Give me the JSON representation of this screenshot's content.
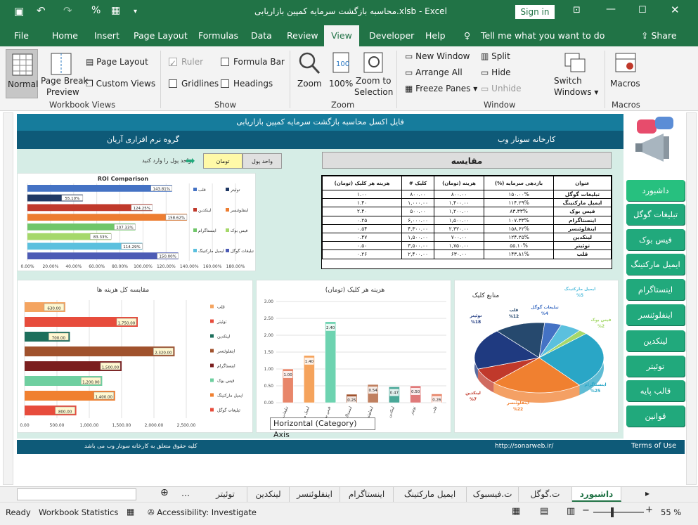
{
  "window": {
    "title": "محاسبه بازگشت سرمایه کمپین بازاریابی.xlsb",
    "app": "Excel",
    "sign_in": "Sign in"
  },
  "ribbon_tabs": [
    "File",
    "Home",
    "Insert",
    "Page Layout",
    "Formulas",
    "Data",
    "Review",
    "View",
    "Developer",
    "Help"
  ],
  "tell_me": "Tell me what you want to do",
  "share": "Share",
  "ribbon": {
    "normal": "Normal",
    "page_break": "Page Break",
    "preview": "Preview",
    "page_layout": "Page Layout",
    "custom_views": "Custom Views",
    "g_workbook": "Workbook Views",
    "ruler": "Ruler",
    "formula_bar": "Formula Bar",
    "gridlines": "Gridlines",
    "headings": "Headings",
    "g_show": "Show",
    "zoom": "Zoom",
    "zoom100": "100%",
    "zoom_to": "Zoom to",
    "selection": "Selection",
    "g_zoom": "Zoom",
    "new_window": "New Window",
    "arrange_all": "Arrange All",
    "freeze": "Freeze Panes",
    "split": "Split",
    "hide": "Hide",
    "unhide": "Unhide",
    "switch": "Switch",
    "windows": "Windows",
    "g_window": "Window",
    "macros": "Macros",
    "g_macros": "Macros"
  },
  "dash": {
    "header": "فایل اکسل محاسبه بازگشت سرمایه کمپین بازاریابی",
    "company": "کارخانه سونار وب",
    "group": "گروه نرم افزاری آریان",
    "unit_label": "واحد پول",
    "unit_value": "تومان",
    "unit_prompt": "واحد پول را وارد کنید",
    "compare_title": "مقایسه",
    "footer_rights": "کلیه حقوق متعلق به کارخانه سونار وب می باشد",
    "footer_url": "http://sonarweb.ir/",
    "terms": "Terms of Use",
    "tooltip": "Horizontal (Category) Axis"
  },
  "table": {
    "headers": [
      "عنوان",
      "بازدهی سرمایه (%)",
      "هزینه (تومان)",
      "کلیک #",
      "هزینه هر کلیک (تومان)"
    ],
    "rows": [
      [
        "تبلیغات گوگل",
        "۱۵۰.۰۰%",
        "۸۰۰.۰۰",
        "۸۰۰.۰۰",
        "۱.۰۰"
      ],
      [
        "ایمیل مارکتینگ",
        "۱۱۴.۲۹%",
        "۱,۴۰۰.۰۰",
        "۱,۰۰۰.۰۰",
        "۱.۴۰"
      ],
      [
        "فیس بوک",
        "۸۳.۳۳%",
        "۱,۲۰۰.۰۰",
        "۵۰۰.۰۰",
        "۲.۴۰"
      ],
      [
        "اینستاگرام",
        "۱۰۷.۳۳%",
        "۱,۵۰۰.۰۰",
        "۶,۰۰۰.۰۰",
        "۰.۲۵"
      ],
      [
        "اینفلوئنسر",
        "۱۵۸.۶۲%",
        "۲,۳۲۰.۰۰",
        "۴,۳۰۰.۰۰",
        "۰.۵۴"
      ],
      [
        "لینکدین",
        "۱۲۴.۲۵%",
        "۷۰۰.۰۰",
        "۱,۵۰۰.۰۰",
        "۰.۴۷"
      ],
      [
        "توئیتر",
        "۵۵.۱۰%",
        "۱,۷۵۰.۰۰",
        "۳,۵۰۰.۰۰",
        "۰.۵۰"
      ],
      [
        "قلب",
        "۱۴۳.۸۱%",
        "۶۳۰.۰۰",
        "۲,۴۰۰.۰۰",
        "۰.۲۶"
      ]
    ]
  },
  "nav": [
    "داشبورد",
    "تبلیغات گوگل",
    "فیس بوک",
    "ایمیل مارکتینگ",
    "اینستاگرام",
    "اینفلوئنسر",
    "لینکدین",
    "توئیتر",
    "قالب پایه",
    "قوانین"
  ],
  "sheet_tabs": [
    "داشبورد",
    "ت.گوگل",
    "ت.فیسبوک",
    "ایمیل مارکتینگ",
    "اینستاگرام",
    "اینفلوئنسر",
    "لینکدین",
    "توئیتر"
  ],
  "status": {
    "ready": "Ready",
    "stats": "Workbook Statistics",
    "access": "Accessibility: Investigate",
    "zoom": "55 %"
  },
  "colors": {
    "excel_green": "#217346",
    "dash_teal": "#167c9c",
    "dash_dark": "#0e5a78",
    "nav_green": "#21a97c",
    "dash_bg": "#d6ede6"
  },
  "chart_data": [
    {
      "type": "bar",
      "title": "ROI Comparison",
      "categories": [
        "قلب",
        "توئیتر",
        "لینکدین",
        "اینفلوئنسر",
        "اینستاگرام",
        "فیس بوک",
        "ایمیل مارکتینگ",
        "تبلیغات گوگل"
      ],
      "values": [
        143.81,
        55.1,
        124.25,
        158.62,
        107.33,
        83.33,
        114.29,
        150.0
      ],
      "value_labels": [
        "143.81%",
        "55.10%",
        "124.25%",
        "158.62%",
        "107.33%",
        "83.33%",
        "114.29%",
        "150.00%"
      ],
      "colors": [
        "#4472c4",
        "#1f3864",
        "#c0392b",
        "#ed7d31",
        "#70c66a",
        "#a5d86a",
        "#5bc0de",
        "#4c5bb5"
      ],
      "xticks": [
        "0.00%",
        "20.00%",
        "40.00%",
        "60.00%",
        "80.00%",
        "100.00%",
        "120.00%",
        "140.00%",
        "160.00%",
        "180.00%"
      ],
      "xlim": [
        0,
        180
      ],
      "legend": "right"
    },
    {
      "type": "bar",
      "title": "مقایسه کل هزینه ها",
      "categories": [
        "قلب",
        "توئیتر",
        "لینکدین",
        "اینفلوئنسر",
        "اینستاگرام",
        "فیس بوک",
        "ایمیل مارکتینگ",
        "تبلیغات گوگل"
      ],
      "values": [
        630,
        1750,
        700,
        2320,
        1500,
        1200,
        1400,
        800
      ],
      "value_labels": [
        "630.00",
        "1,750.00",
        "700.00",
        "2,320.00",
        "1,500.00",
        "1,200.00",
        "1,400.00",
        "800.00"
      ],
      "colors": [
        "#f4a460",
        "#e74c3c",
        "#1d6f5c",
        "#a0522d",
        "#7b1f1f",
        "#6fcfa0",
        "#f08030",
        "#e74c3c"
      ],
      "xticks": [
        "0.00",
        "500.00",
        "1,000.00",
        "1,500.00",
        "2,000.00",
        "2,500.00"
      ],
      "xlim": [
        0,
        2500
      ],
      "legend": "right"
    },
    {
      "type": "bar",
      "title": "هزینه هر کلیک (تومان)",
      "categories": [
        "تبلیغات گوگل",
        "ایمیل مارکتینگ",
        "فیس بوک",
        "اینستاگرام",
        "اینفلوئنسر",
        "لینکدین",
        "توئیتر",
        "قلب"
      ],
      "values": [
        1.0,
        1.4,
        2.4,
        0.25,
        0.54,
        0.47,
        0.5,
        0.26
      ],
      "value_labels": [
        "1.00",
        "1.40",
        "2.40",
        "0.25",
        "0.54",
        "0.47",
        "0.50",
        "0.26"
      ],
      "colors": [
        "#e8866a",
        "#f5a35c",
        "#6dd3b0",
        "#a0522d",
        "#c08060",
        "#4aa898",
        "#e07a7a",
        "#e8866a"
      ],
      "yticks": [
        "0.00",
        "0.50",
        "1.00",
        "1.50",
        "2.00",
        "2.50",
        "3.00"
      ],
      "ylim": [
        0,
        3
      ]
    },
    {
      "type": "pie",
      "title": "منابع کلیک",
      "labels": [
        "ایمیل مارکتینگ",
        "فیس بوک",
        "اینستاگرام",
        "اینفلوئنسر",
        "لینکدین",
        "توئیتر",
        "قلب",
        "تبلیغات گوگل"
      ],
      "values": [
        5,
        2,
        25,
        22,
        7,
        18,
        12,
        4
      ],
      "value_labels": [
        "%5",
        "%2",
        "%25",
        "%22",
        "%7",
        "%18",
        "%12",
        "%4"
      ],
      "colors": [
        "#5bc0de",
        "#a5d86a",
        "#2aa6c6",
        "#f08030",
        "#c0392b",
        "#1f3a80",
        "#26496e",
        "#4472c4"
      ]
    }
  ]
}
